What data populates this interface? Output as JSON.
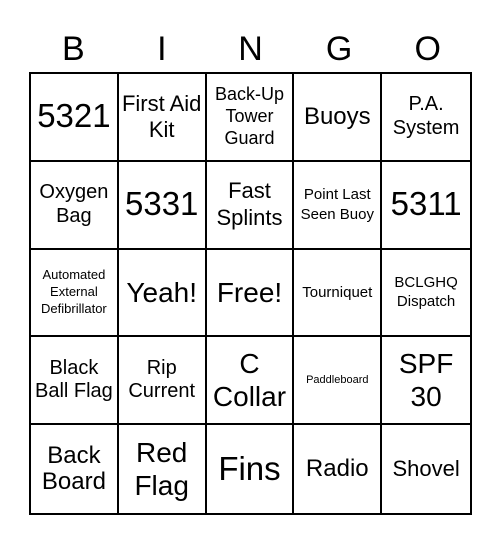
{
  "title_letters": [
    "B",
    "I",
    "N",
    "G",
    "O"
  ],
  "cells": [
    {
      "text": "5321",
      "size": "s-xl"
    },
    {
      "text": "First Aid Kit",
      "size": "s-m"
    },
    {
      "text": "Back-Up Tower Guard",
      "size": "s-sm"
    },
    {
      "text": "Buoys",
      "size": "s-lm"
    },
    {
      "text": "P.A. System",
      "size": "s-ms"
    },
    {
      "text": "Oxygen Bag",
      "size": "s-ms"
    },
    {
      "text": "5331",
      "size": "s-xl"
    },
    {
      "text": "Fast Splints",
      "size": "s-m"
    },
    {
      "text": "Point Last Seen Buoy",
      "size": "s-s"
    },
    {
      "text": "5311",
      "size": "s-xl"
    },
    {
      "text": "Automated External Defibrillator",
      "size": "s-xs"
    },
    {
      "text": "Yeah!",
      "size": "s-l"
    },
    {
      "text": "Free!",
      "size": "s-l"
    },
    {
      "text": "Tourniquet",
      "size": "s-s"
    },
    {
      "text": "BCLGHQ Dispatch",
      "size": "s-s"
    },
    {
      "text": "Black Ball Flag",
      "size": "s-ms"
    },
    {
      "text": "Rip Current",
      "size": "s-ms"
    },
    {
      "text": "C Collar",
      "size": "s-l"
    },
    {
      "text": "Paddleboard",
      "size": "s-xxs"
    },
    {
      "text": "SPF 30",
      "size": "s-l"
    },
    {
      "text": "Back Board",
      "size": "s-lm"
    },
    {
      "text": "Red Flag",
      "size": "s-l"
    },
    {
      "text": "Fins",
      "size": "s-xl"
    },
    {
      "text": "Radio",
      "size": "s-lm"
    },
    {
      "text": "Shovel",
      "size": "s-m"
    }
  ]
}
